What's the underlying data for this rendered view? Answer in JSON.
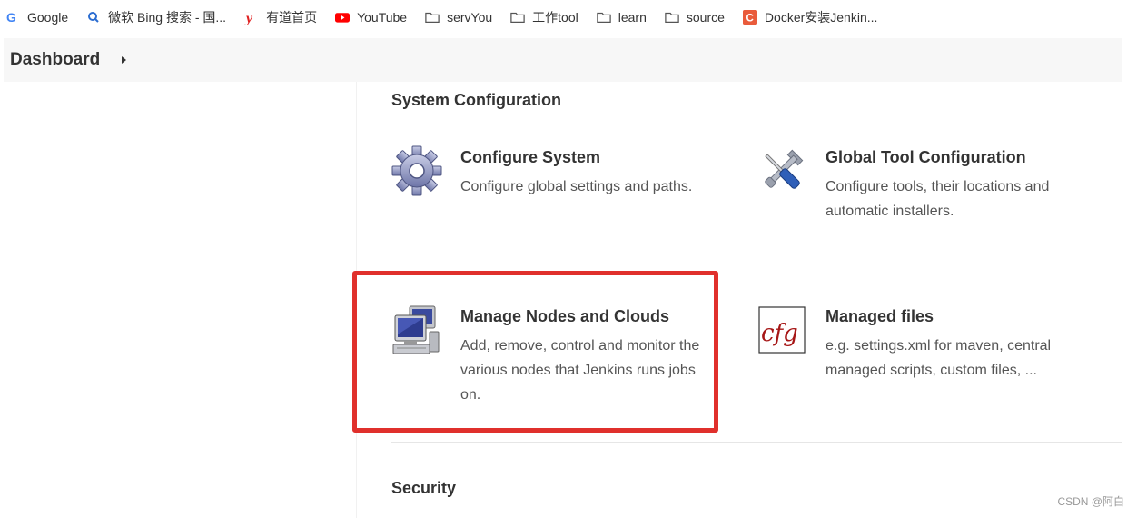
{
  "bookmarks": [
    {
      "label": "Google",
      "icon": "google-icon"
    },
    {
      "label": "微软 Bing 搜索 - 国...",
      "icon": "bing-search-icon"
    },
    {
      "label": "有道首页",
      "icon": "youdao-icon"
    },
    {
      "label": "YouTube",
      "icon": "youtube-icon"
    },
    {
      "label": "servYou",
      "icon": "folder-icon"
    },
    {
      "label": "工作tool",
      "icon": "folder-icon"
    },
    {
      "label": "learn",
      "icon": "folder-icon"
    },
    {
      "label": "source",
      "icon": "folder-icon"
    },
    {
      "label": "Docker安装Jenkin...",
      "icon": "csdn-icon"
    }
  ],
  "breadcrumb": {
    "label": "Dashboard"
  },
  "sections": {
    "system": {
      "title": "System Configuration"
    },
    "security": {
      "title": "Security"
    }
  },
  "items": {
    "configure_system": {
      "title": "Configure System",
      "desc": "Configure global settings and paths.",
      "icon": "gear-icon"
    },
    "global_tool": {
      "title": "Global Tool Configuration",
      "desc": "Configure tools, their locations and automatic installers.",
      "icon": "tools-icon"
    },
    "manage_nodes": {
      "title": "Manage Nodes and Clouds",
      "desc": "Add, remove, control and monitor the various nodes that Jenkins runs jobs on.",
      "icon": "computer-icon"
    },
    "managed_files": {
      "title": "Managed files",
      "desc": "e.g. settings.xml for maven, central managed scripts, custom files, ...",
      "icon": "cfg-file-icon"
    }
  },
  "watermark": "CSDN @阿白",
  "colors": {
    "highlight": "#e0302c",
    "crumb_bg": "#f7f7f7"
  }
}
